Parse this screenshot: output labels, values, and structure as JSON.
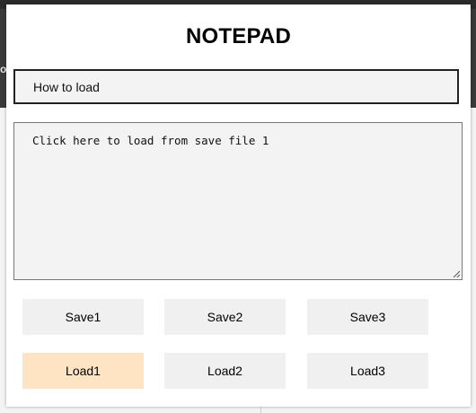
{
  "app": {
    "title": "NOTEPAD"
  },
  "note": {
    "name_value": "How to load",
    "content_value": "Click here to load from save file 1"
  },
  "buttons": {
    "save": [
      "Save1",
      "Save2",
      "Save3"
    ],
    "load": [
      "Load1",
      "Load2",
      "Load3"
    ],
    "active": "Load1",
    "active_color": "#ffe4c4"
  },
  "backdrop": {
    "partial_text": "o"
  }
}
